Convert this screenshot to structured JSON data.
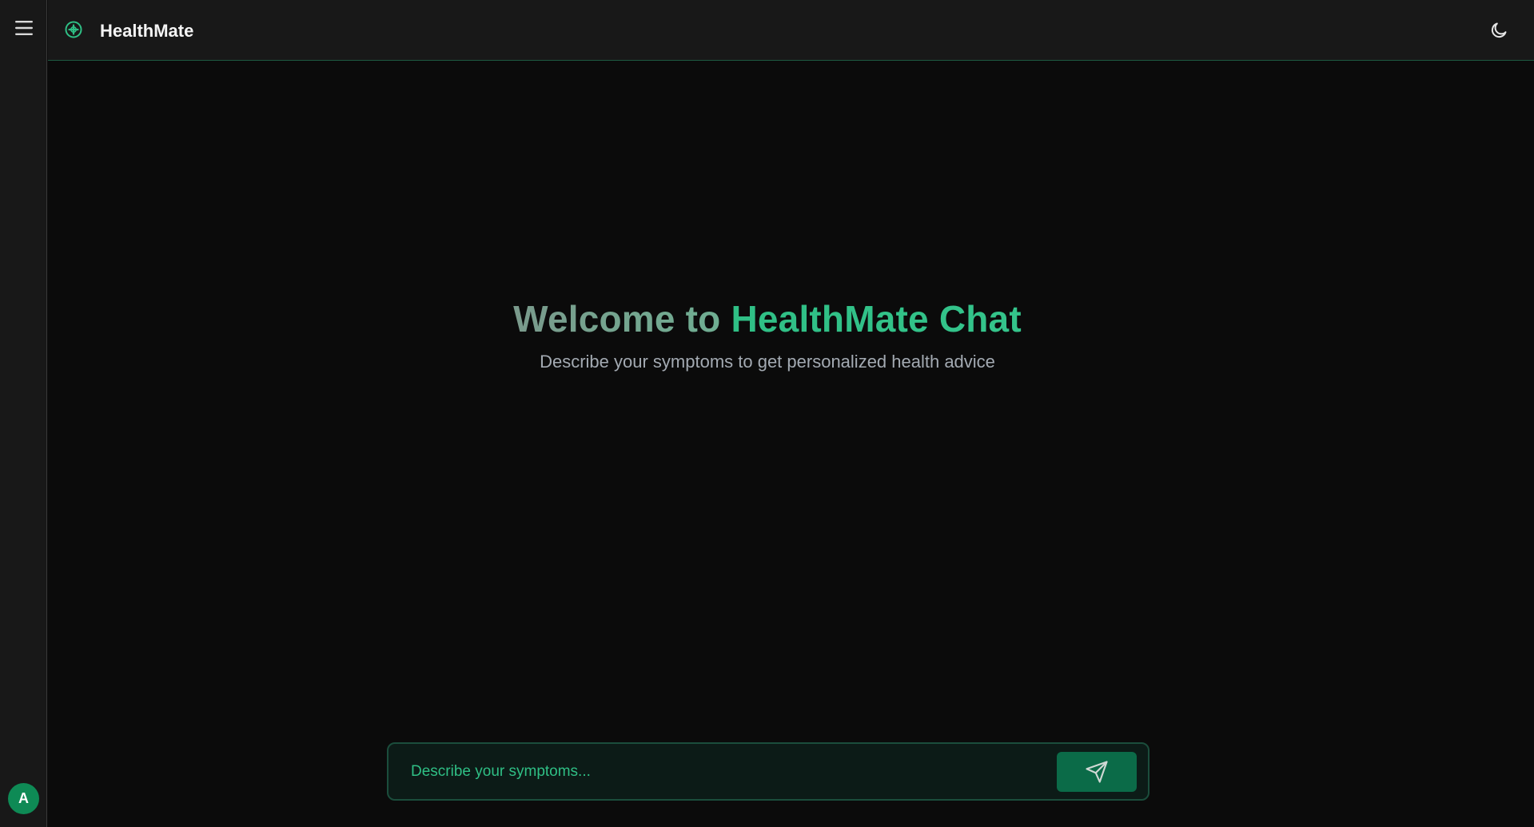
{
  "app": {
    "title": "HealthMate"
  },
  "sidebar": {
    "menu_icon": "hamburger-menu-icon",
    "avatar_initial": "A"
  },
  "header": {
    "logo_icon": "medical-plus-icon",
    "theme_toggle_icon": "moon-icon"
  },
  "welcome": {
    "title_part1": "Welcome to",
    "title_part2": "HealthMate Chat",
    "subtitle": "Describe your symptoms to get personalized health advice"
  },
  "chat_input": {
    "value": "",
    "placeholder": "Describe your symptoms...",
    "send_icon": "paper-plane-send-icon"
  },
  "colors": {
    "accent": "#2fbf85",
    "accent_dark": "#0b6b48",
    "avatar_bg": "#0e8a55",
    "background": "#0b0b0b",
    "panel": "#181818"
  }
}
